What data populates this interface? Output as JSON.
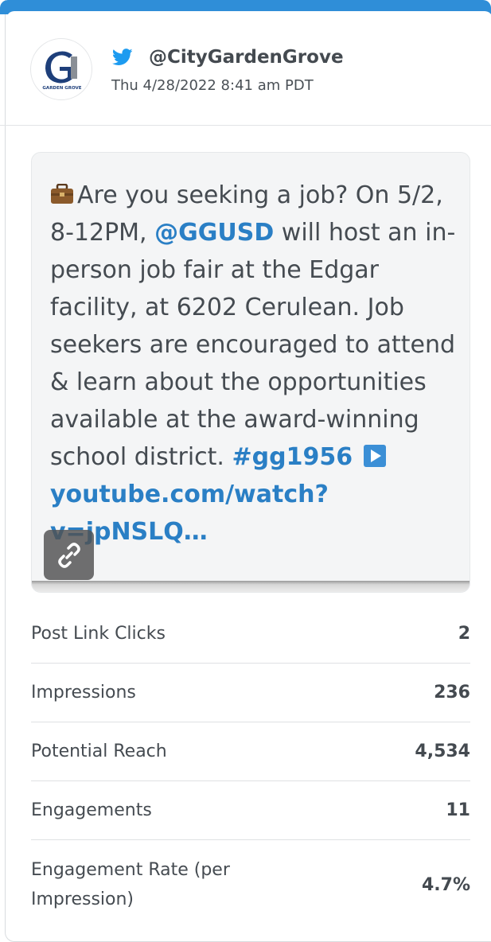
{
  "account": {
    "handle": "@CityGardenGrove",
    "timestamp": "Thu 4/28/2022 8:41 am PDT",
    "avatar_text": "GARDEN GROVE",
    "network_icon": "twitter-icon"
  },
  "post": {
    "text_intro": "Are you seeking a job? On 5/2, 8-12PM, ",
    "mention": "@GGUSD",
    "text_body": " will host an in-person job fair at the Edgar facility, at 6202 Cerulean. Job seekers are encouraged to attend & learn about the opportunities available at the award-winning school district. ",
    "hashtag": "#gg1956",
    "link": "youtube.com/watch?v=jpNSLQ…",
    "emoji": "briefcase-icon",
    "link_icon": "link-icon"
  },
  "metrics": [
    {
      "label": "Post Link Clicks",
      "value": "2"
    },
    {
      "label": "Impressions",
      "value": "236"
    },
    {
      "label": "Potential Reach",
      "value": "4,534"
    },
    {
      "label": "Engagements",
      "value": "11"
    },
    {
      "label": "Engagement Rate (per Impression)",
      "value": "4.7%"
    }
  ],
  "colors": {
    "accent": "#2a7fc5",
    "top_bar": "#2f8ed8",
    "twitter": "#1d9bf0"
  }
}
